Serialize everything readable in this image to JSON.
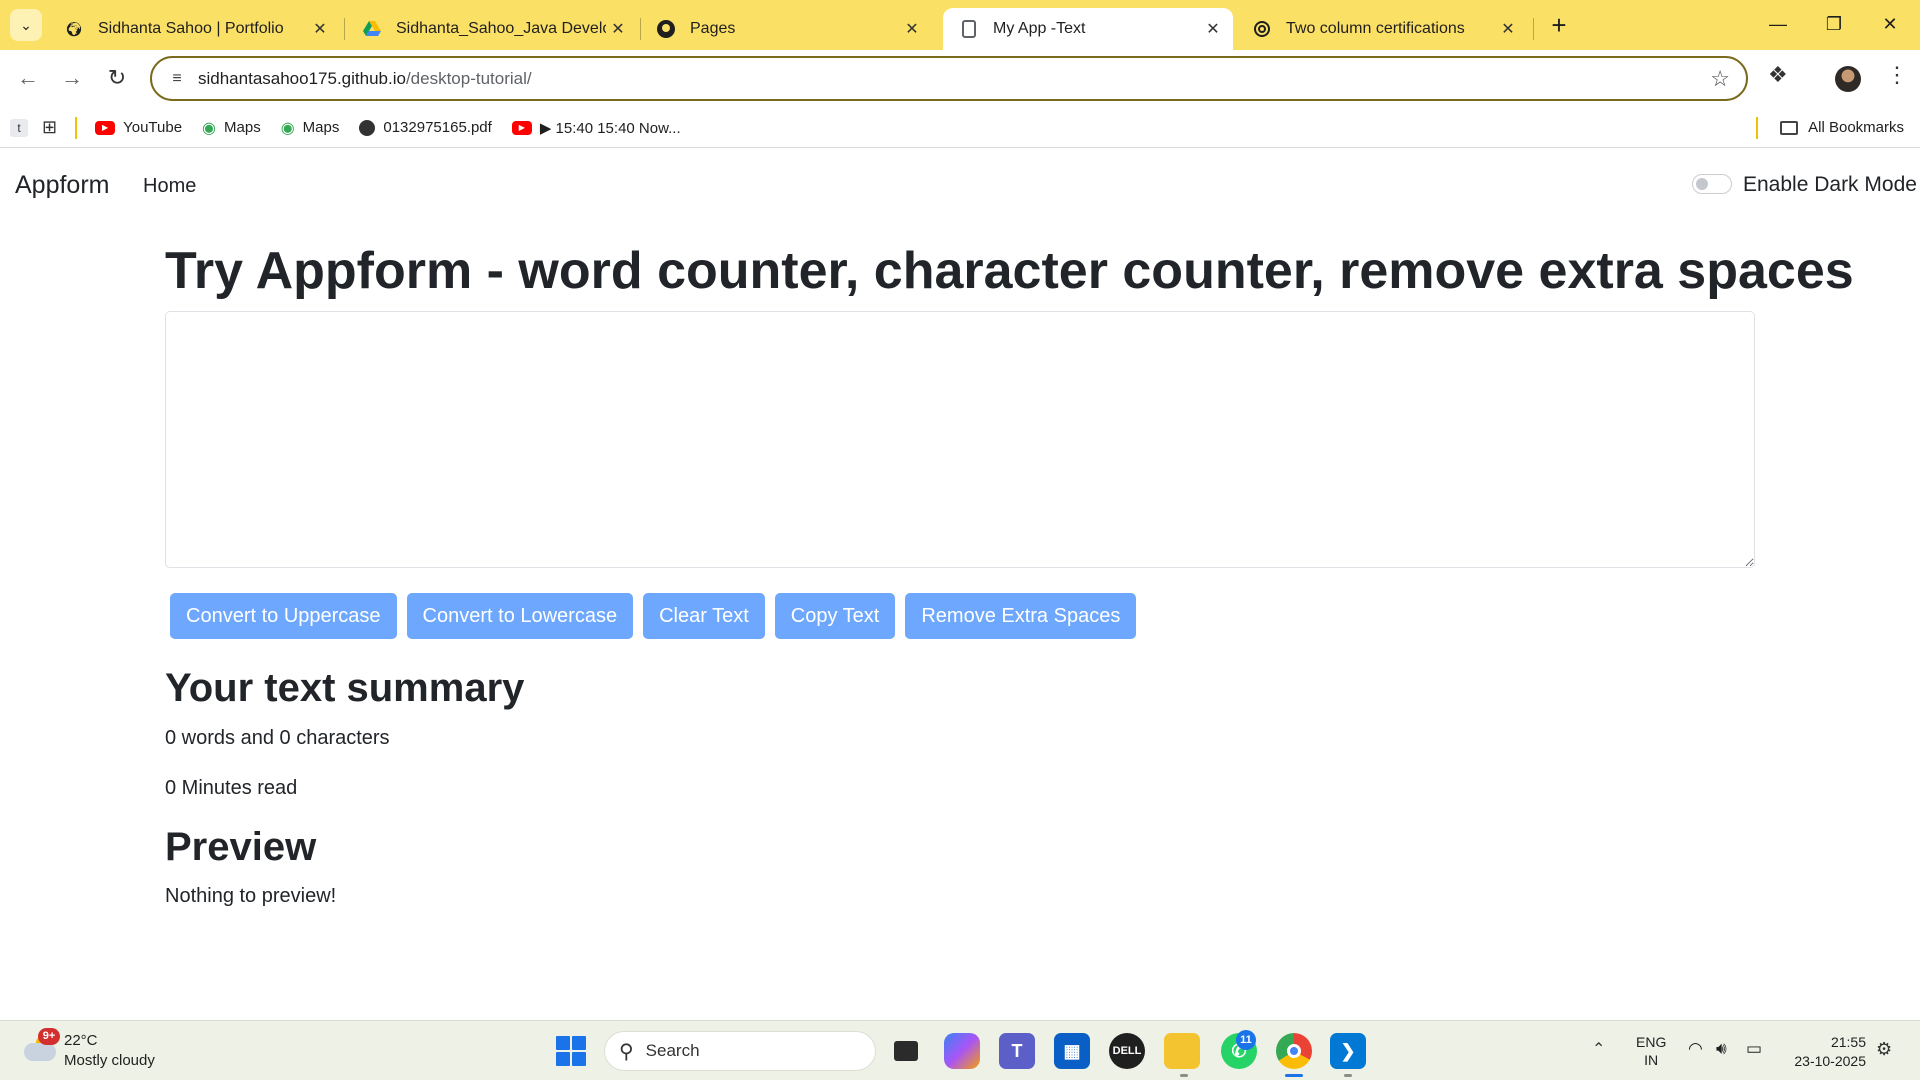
{
  "browser": {
    "tabs": [
      {
        "title": "Sidhanta Sahoo | Portfolio",
        "icon": "globe-icon",
        "active": false
      },
      {
        "title": "Sidhanta_Sahoo_Java Develope",
        "icon": "drive-icon",
        "active": false
      },
      {
        "title": "Pages",
        "icon": "github-icon",
        "active": false
      },
      {
        "title": "My App -Text",
        "icon": "page-icon",
        "active": true
      },
      {
        "title": "Two column certifications",
        "icon": "openai-icon",
        "active": false
      }
    ],
    "url_host": "sidhantasahoo175.github.io",
    "url_path": "/desktop-tutorial/",
    "bookmarks": [
      {
        "label": "YouTube",
        "icon": "youtube-icon"
      },
      {
        "label": "Maps",
        "icon": "maps-icon"
      },
      {
        "label": "Maps",
        "icon": "maps-icon"
      },
      {
        "label": "0132975165.pdf",
        "icon": "globe-icon"
      },
      {
        "label": "▶ 15:40 15:40 Now...",
        "icon": "youtube-icon"
      }
    ],
    "all_bookmarks": "All Bookmarks"
  },
  "app": {
    "brand": "Appform",
    "nav_home": "Home",
    "dark_mode_label": "Enable Dark Mode",
    "dark_mode_on": false,
    "heading": "Try Appform - word counter, character counter, remove extra spaces",
    "textarea_value": "",
    "buttons": [
      "Convert to Uppercase",
      "Convert to Lowercase",
      "Clear Text",
      "Copy Text",
      "Remove Extra Spaces"
    ],
    "button_color": "#6ea8fe",
    "summary_heading": "Your text summary",
    "count_text": "0 words and 0 characters",
    "minutes_text": "0 Minutes read",
    "preview_heading": "Preview",
    "preview_text": "Nothing to preview!"
  },
  "taskbar": {
    "weather_badge": "9+",
    "temperature": "22°C",
    "condition": "Mostly cloudy",
    "search_placeholder": "Search",
    "whatsapp_badge": "11",
    "lang_line1": "ENG",
    "lang_line2": "IN",
    "time": "21:55",
    "date": "23-10-2025"
  }
}
